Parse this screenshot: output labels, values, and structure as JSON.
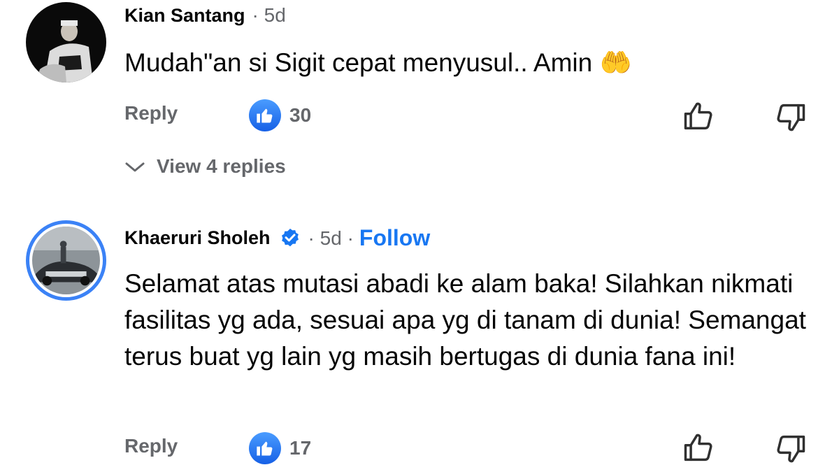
{
  "comments": [
    {
      "author": "Kian Santang",
      "time": "· 5d",
      "text": "Mudah\"an si Sigit cepat menyusul.. Amin",
      "emoji": "🤲",
      "reply_label": "Reply",
      "like_count": "30",
      "view_replies": "View 4 replies"
    },
    {
      "author": "Khaeruri Sholeh",
      "verified": true,
      "time": "· 5d ·",
      "follow_label": "Follow",
      "text": "Selamat atas mutasi abadi ke alam baka! Silahkan nikmati fasilitas yg ada, sesuai apa yg di tanam di dunia! Semangat terus buat yg lain yg masih bertugas di dunia fana ini!",
      "reply_label": "Reply",
      "like_count": "17"
    }
  ],
  "icons": {
    "like_reaction": "like-reaction-icon",
    "thumbs_up": "thumbs-up-icon",
    "thumbs_down": "thumbs-down-icon",
    "verified": "verified-badge-icon",
    "chevron": "chevron-down-icon"
  },
  "colors": {
    "accent": "#1877f2",
    "muted": "#65676b",
    "verified": "#1877f2"
  }
}
